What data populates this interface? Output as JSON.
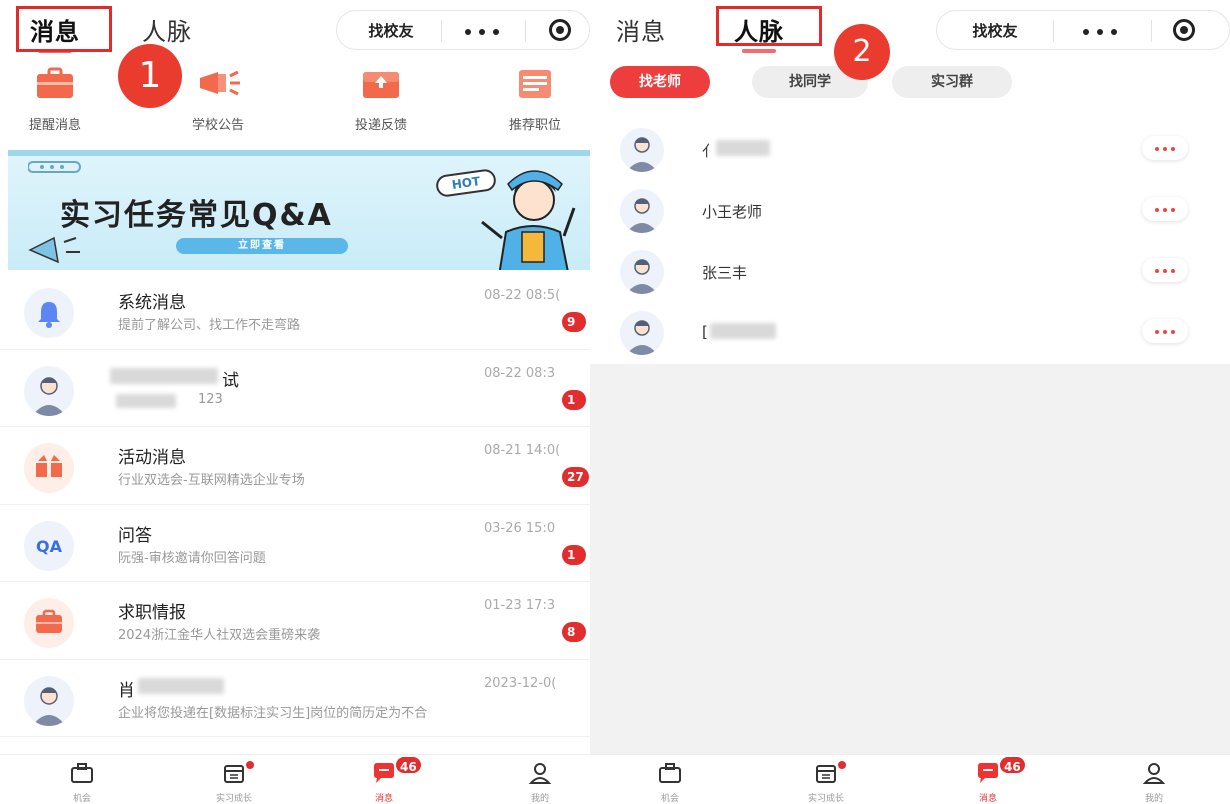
{
  "left_screen": {
    "tabs": [
      {
        "label": "消息",
        "active": true
      },
      {
        "label": "人脉",
        "active": false
      }
    ],
    "callout_number": "1",
    "capsule": {
      "find_alumni": "找校友",
      "more_icon": "more-dots",
      "close_icon": "target-circle"
    },
    "shortcuts": [
      {
        "label": "提醒消息",
        "icon": "briefcase-icon",
        "color": "#f2694c"
      },
      {
        "label": "学校公告",
        "icon": "megaphone-icon",
        "color": "#f2694c"
      },
      {
        "label": "投递反馈",
        "icon": "upload-icon",
        "color": "#f2694c"
      },
      {
        "label": "推荐职位",
        "icon": "list-icon",
        "color": "#f2694c"
      }
    ],
    "banner": {
      "title": "实习任务常见Q&A",
      "button": "立即查看",
      "hot": "HOT"
    },
    "messages": [
      {
        "name": "系统消息",
        "preview": "提前了解公司、找工作不走弯路",
        "time": "08-22 08:5(",
        "badge": "9",
        "avatar": "bell-icon"
      },
      {
        "name": "试",
        "preview": "123",
        "time": "08-22 08:3",
        "badge": "1",
        "avatar": "person-avatar"
      },
      {
        "name": "活动消息",
        "preview": "行业双选会-互联网精选企业专场",
        "time": "08-21 14:0(",
        "badge": "27",
        "avatar": "gift-icon"
      },
      {
        "name": "问答",
        "preview": "阮强-审核邀请你回答问题",
        "time": "03-26 15:0",
        "badge": "1",
        "avatar": "qa-icon"
      },
      {
        "name": "求职情报",
        "preview": "2024浙江金华人社双选会重磅来袭",
        "time": "01-23 17:3",
        "badge": "8",
        "avatar": "briefcase-icon"
      },
      {
        "name": "肖",
        "preview": "企业将您投递在[数据标注实习生]岗位的简历定为不合",
        "time": "2023-12-0(",
        "badge": "",
        "avatar": "person-avatar"
      }
    ],
    "tabbar": [
      {
        "label": "机会",
        "icon": "briefcase-icon"
      },
      {
        "label": "实习成长",
        "icon": "calendar-icon"
      },
      {
        "label": "消息",
        "icon": "chat-icon",
        "badge": "46"
      },
      {
        "label": "我的",
        "icon": "user-icon"
      }
    ]
  },
  "right_screen": {
    "tabs": [
      {
        "label": "消息",
        "active": false
      },
      {
        "label": "人脉",
        "active": true
      }
    ],
    "callout_number": "2",
    "capsule": {
      "find_alumni": "找校友"
    },
    "chips": [
      {
        "label": "找老师",
        "active": true
      },
      {
        "label": "找同学",
        "active": false
      },
      {
        "label": "实习群",
        "active": false
      }
    ],
    "contacts": [
      {
        "name": "亻"
      },
      {
        "name": "小王老师"
      },
      {
        "name": "张三丰"
      },
      {
        "name": "["
      }
    ],
    "tabbar": [
      {
        "label": "机会"
      },
      {
        "label": "实习成长"
      },
      {
        "label": "消息",
        "badge": "46"
      },
      {
        "label": "我的"
      }
    ]
  },
  "colors": {
    "accent": "#ee3d3d",
    "callout": "#ea3b2f",
    "highlight_box": "#e02c2c"
  }
}
